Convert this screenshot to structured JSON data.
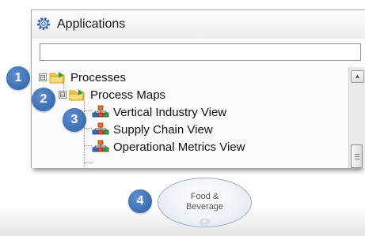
{
  "panel": {
    "title": "Applications",
    "header_icon": "gear-icon",
    "search": {
      "value": "",
      "placeholder": ""
    }
  },
  "tree": {
    "items": [
      {
        "label": "Processes",
        "expander": "⊟",
        "icon": "folder-icon"
      },
      {
        "label": "Process Maps",
        "expander": "⊟",
        "icon": "folder-icon"
      },
      {
        "label": "Vertical Industry View",
        "icon": "hierarchy-icon"
      },
      {
        "label": "Supply Chain View",
        "icon": "hierarchy-icon"
      },
      {
        "label": "Operational Metrics View",
        "icon": "hierarchy-icon"
      }
    ]
  },
  "badges": [
    "1",
    "2",
    "3",
    "4"
  ],
  "node": {
    "label": "Food &\nBeverage",
    "caret": "▼"
  },
  "colors": {
    "badge": "#2c5ea3",
    "folder": "#f2c94c",
    "folder_arrow": "#2e9e3e"
  }
}
